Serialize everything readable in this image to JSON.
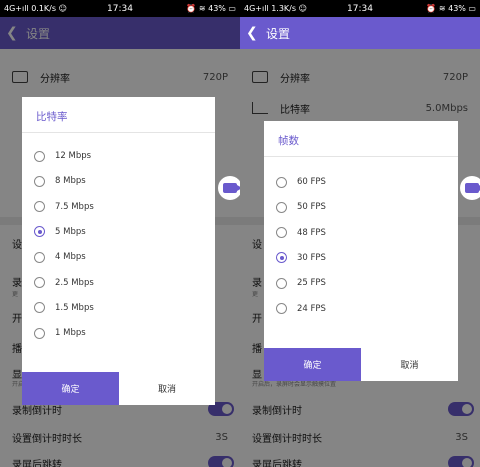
{
  "left": {
    "status": {
      "left": "4G+ıll 0.1K/s ☺",
      "time": "17:34",
      "right": "⏰ ≋ 43% ▭"
    },
    "appbar": {
      "title": "设置"
    },
    "settings": {
      "resolution_label": "分辨率",
      "resolution_value": "720P",
      "item4_label": "设",
      "item5_label": "录",
      "item5_sub": "更",
      "item6_label": "开",
      "item7_label": "播",
      "item8_label": "显",
      "item8_sub": "开启",
      "countdown_label": "录制倒计时",
      "countdown_duration_label": "设置倒计时时长",
      "countdown_duration_value": "3S",
      "after_record_label": "录屏后跳转"
    },
    "dialog": {
      "title": "比特率",
      "options": [
        "12 Mbps",
        "8 Mbps",
        "7.5 Mbps",
        "5 Mbps",
        "4 Mbps",
        "2.5 Mbps",
        "1.5 Mbps",
        "1 Mbps"
      ],
      "selected_index": 3,
      "confirm": "确定",
      "cancel": "取消"
    }
  },
  "right": {
    "status": {
      "left": "4G+ıll 1.3K/s ☺",
      "time": "17:34",
      "right": "⏰ ≋ 43% ▭"
    },
    "appbar": {
      "title": "设置"
    },
    "settings": {
      "resolution_label": "分辨率",
      "resolution_value": "720P",
      "bitrate_label": "比特率",
      "bitrate_value": "5.0Mbps",
      "item4_label": "设",
      "item5_label": "录",
      "item5_sub": "更",
      "item6_label": "开",
      "item7_label": "播",
      "item8_label": "显",
      "item8_sub": "开启后，录屏时会显示触摸位置",
      "countdown_label": "录制倒计时",
      "countdown_duration_label": "设置倒计时时长",
      "countdown_duration_value": "3S",
      "after_record_label": "录屏后跳转"
    },
    "dialog": {
      "title": "帧数",
      "options": [
        "60 FPS",
        "50 FPS",
        "48 FPS",
        "30 FPS",
        "25 FPS",
        "24 FPS"
      ],
      "selected_index": 3,
      "confirm": "确定",
      "cancel": "取消"
    }
  },
  "colors": {
    "accent": "#6a5acd",
    "overlay": "rgba(0,0,0,0.48)"
  }
}
